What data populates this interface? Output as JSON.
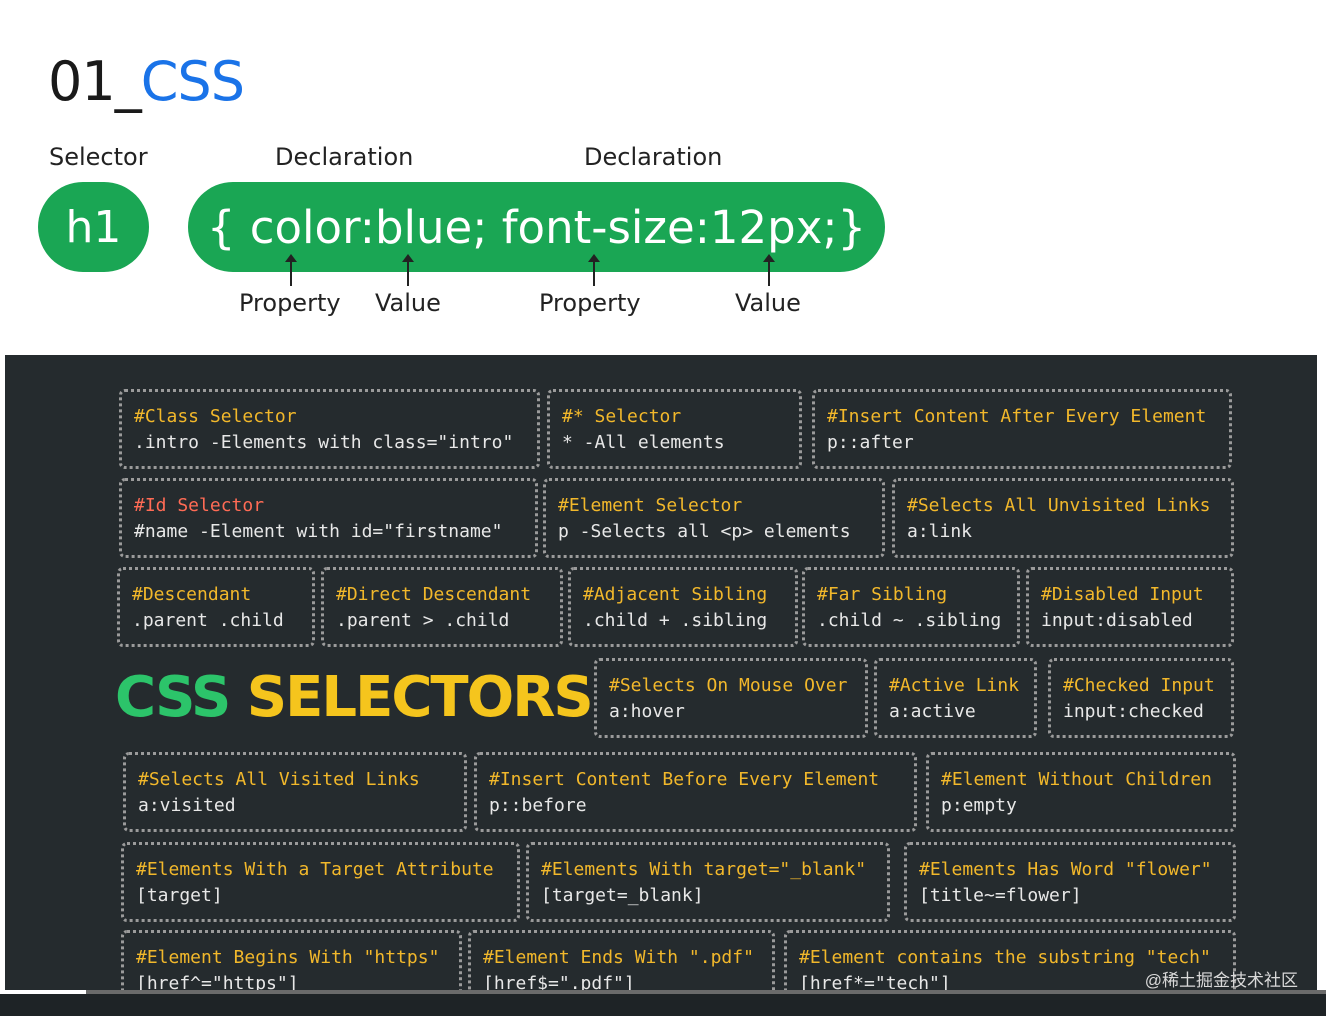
{
  "header": {
    "title_prefix": "01_",
    "title_accent": "CSS"
  },
  "syntax": {
    "selector_label": "Selector",
    "declaration_label_1": "Declaration",
    "declaration_label_2": "Declaration",
    "selector_value": "h1",
    "declaration_value": "{ color:blue; font-size:12px;}",
    "property_label_1": "Property",
    "value_label_1": "Value",
    "property_label_2": "Property",
    "value_label_2": "Value",
    "pill_color": "#1aa654"
  },
  "cheatsheet": {
    "big_title_green": "CSS",
    "big_title_yellow": "SELECTORS",
    "cards": [
      {
        "head": "#Class Selector",
        "code": ".intro -Elements with class=\"intro\""
      },
      {
        "head": "#* Selector",
        "code": "*  -All elements"
      },
      {
        "head": "#Insert Content After Every Element",
        "code": "p::after"
      },
      {
        "head": "#Id Selector",
        "code": "#name  -Element with id=\"firstname\""
      },
      {
        "head": "#Element Selector",
        "code": "p  -Selects all <p> elements"
      },
      {
        "head": "#Selects All Unvisited Links",
        "code": "a:link"
      },
      {
        "head": "#Descendant",
        "code": ".parent .child"
      },
      {
        "head": "#Direct Descendant",
        "code": ".parent > .child"
      },
      {
        "head": "#Adjacent Sibling",
        "code": ".child + .sibling"
      },
      {
        "head": "#Far Sibling",
        "code": ".child ~ .sibling"
      },
      {
        "head": "#Disabled Input",
        "code": "input:disabled"
      },
      {
        "head": "#Selects On Mouse Over",
        "code": "a:hover"
      },
      {
        "head": "#Active Link",
        "code": "a:active"
      },
      {
        "head": "#Checked Input",
        "code": "input:checked"
      },
      {
        "head": "#Selects All Visited Links",
        "code": "a:visited"
      },
      {
        "head": "#Insert Content Before Every Element",
        "code": "p::before"
      },
      {
        "head": "#Element Without Children",
        "code": "p:empty"
      },
      {
        "head": "#Elements With a Target Attribute",
        "code": "[target]"
      },
      {
        "head": "#Elements With target=\"_blank\"",
        "code": "[target=_blank]"
      },
      {
        "head": "#Elements Has Word \"flower\"",
        "code": "[title~=flower]"
      },
      {
        "head": "#Element Begins With \"https\"",
        "code": "[href^=\"https\"]"
      },
      {
        "head": "#Element Ends With \".pdf\"",
        "code": "[href$=\".pdf\"]"
      },
      {
        "head": "#Element contains the substring \"tech\"",
        "code": "[href*=\"tech\"]"
      }
    ]
  },
  "watermark": "@稀土掘金技术社区",
  "video": {
    "progress": 0.065
  }
}
